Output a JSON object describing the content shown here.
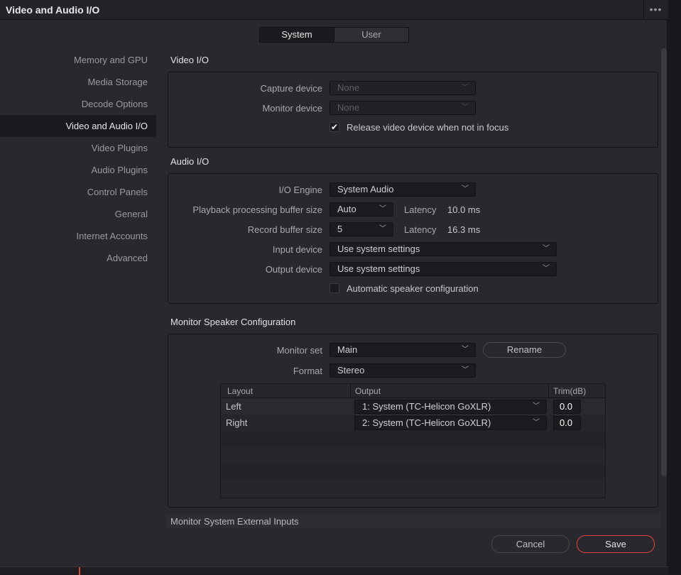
{
  "window": {
    "title": "Video and Audio I/O",
    "more_icon": "ellipsis-icon"
  },
  "tabs": [
    {
      "label": "System",
      "active": true
    },
    {
      "label": "User",
      "active": false
    }
  ],
  "sidebar": {
    "items": [
      {
        "label": "Memory and GPU"
      },
      {
        "label": "Media Storage"
      },
      {
        "label": "Decode Options"
      },
      {
        "label": "Video and Audio I/O",
        "active": true
      },
      {
        "label": "Video Plugins"
      },
      {
        "label": "Audio Plugins"
      },
      {
        "label": "Control Panels"
      },
      {
        "label": "General"
      },
      {
        "label": "Internet Accounts"
      },
      {
        "label": "Advanced"
      }
    ]
  },
  "video_io": {
    "heading": "Video I/O",
    "capture_label": "Capture device",
    "capture_value": "None",
    "monitor_label": "Monitor device",
    "monitor_value": "None",
    "release_label": "Release video device when not in focus",
    "release_checked": true
  },
  "audio_io": {
    "heading": "Audio I/O",
    "engine_label": "I/O Engine",
    "engine_value": "System Audio",
    "playback_label": "Playback processing buffer size",
    "playback_value": "Auto",
    "playback_latency_label": "Latency",
    "playback_latency": "10.0 ms",
    "record_label": "Record buffer size",
    "record_value": "5",
    "record_latency_label": "Latency",
    "record_latency": "16.3 ms",
    "input_label": "Input device",
    "input_value": "Use system settings",
    "output_label": "Output device",
    "output_value": "Use system settings",
    "auto_speaker_label": "Automatic speaker configuration",
    "auto_speaker_checked": false
  },
  "monitor": {
    "heading": "Monitor Speaker Configuration",
    "set_label": "Monitor set",
    "set_value": "Main",
    "rename": "Rename",
    "format_label": "Format",
    "format_value": "Stereo",
    "columns": [
      "Layout",
      "Output",
      "Trim(dB)"
    ],
    "rows": [
      {
        "layout": "Left",
        "output": "1: System (TC-Helicon GoXLR)",
        "trim": "0.0"
      },
      {
        "layout": "Right",
        "output": "2: System (TC-Helicon GoXLR)",
        "trim": "0.0"
      }
    ]
  },
  "next_heading": "Monitor System External Inputs",
  "footer": {
    "cancel": "Cancel",
    "save": "Save"
  },
  "colors": {
    "accent_save": "#e0453c",
    "bg": "#28282e"
  }
}
